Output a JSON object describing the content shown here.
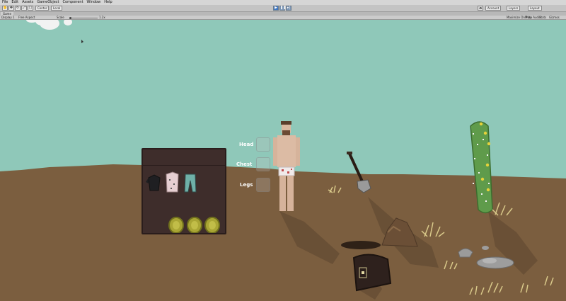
{
  "menu": {
    "items": [
      "File",
      "Edit",
      "Assets",
      "GameObject",
      "Component",
      "Window",
      "Help"
    ]
  },
  "toolbar": {
    "pivot_label": "Center",
    "space_label": "Local",
    "account_label": "Account",
    "layers_label": "Layers",
    "layout_label": "Layout"
  },
  "tabs": {
    "game_tab": "Game"
  },
  "game_toolbar": {
    "display": "Display 1",
    "aspect": "Free Aspect",
    "scale_label": "Scale",
    "scale_value": "1.2x",
    "maximize": "Maximize On Play",
    "mute": "Mute Audio",
    "stats": "Stats",
    "gizmos": "Gizmos"
  },
  "equipment": {
    "head_label": "Head",
    "chest_label": "Chest",
    "legs_label": "Legs"
  },
  "colors": {
    "sky": "#8fc8b9",
    "ground": "#7b5e3f",
    "panel": "#3e2d2b",
    "cactus": "#5f9b4b"
  },
  "icons": [
    "hand-icon",
    "move-icon",
    "rotate-icon",
    "scale-icon",
    "rect-icon",
    "play-icon",
    "pause-icon",
    "step-icon",
    "cloud-icon"
  ]
}
